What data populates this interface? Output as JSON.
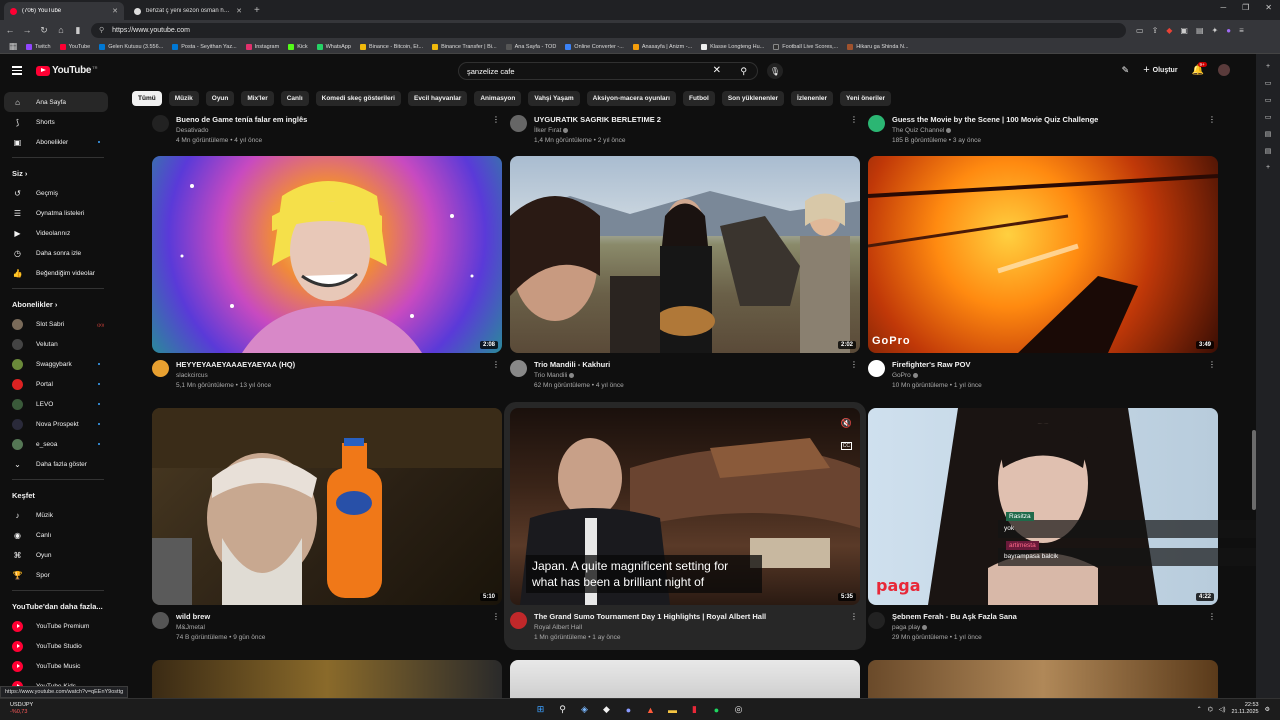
{
  "browser": {
    "tabs": [
      {
        "title": "(706) YouTube",
        "active": true
      },
      {
        "title": "behzat ç yeni sezon osman harun - G",
        "active": false
      }
    ],
    "new_tab": "+",
    "url": "https://www.youtube.com",
    "bookmarks": [
      "Twitch",
      "YouTube",
      "Gelen Kutusu (3.556...",
      "Posta - Seyithan Yaz...",
      "Instagram",
      "Kick",
      "WhatsApp",
      "Binance - Bitcoin, Et...",
      "Binance Transfer | Bi...",
      "Ana Sayfa - TOD",
      "Online Converter -...",
      "Anasayfa | Anizm -...",
      "Klasse Longteng Hu...",
      "Football Live Scores,...",
      "Hikaru ga Shinda N..."
    ],
    "status_url": "https://www.youtube.com/watch?v=qEEnY9osttg"
  },
  "header": {
    "logo_text": "YouTube",
    "country": "TR",
    "search_value": "şanzelize cafe",
    "create_label": "Oluştur",
    "notif_count": "9+"
  },
  "chips": [
    "Tümü",
    "Müzik",
    "Oyun",
    "Mix'ler",
    "Canlı",
    "Komedi skeç gösterileri",
    "Evcil hayvanlar",
    "Animasyon",
    "Vahşi Yaşam",
    "Aksiyon-macera oyunları",
    "Futbol",
    "Son yüklenenler",
    "İzlenenler",
    "Yeni öneriler"
  ],
  "sidebar": {
    "main": [
      {
        "label": "Ana Sayfa",
        "icon": "home-icon"
      },
      {
        "label": "Shorts",
        "icon": "shorts-icon"
      },
      {
        "label": "Abonelikler",
        "icon": "subscriptions-icon"
      }
    ],
    "you_title": "Siz",
    "you": [
      {
        "label": "Geçmiş",
        "icon": "history-icon"
      },
      {
        "label": "Oynatma listeleri",
        "icon": "playlists-icon"
      },
      {
        "label": "Videolarınız",
        "icon": "your-videos-icon"
      },
      {
        "label": "Daha sonra izle",
        "icon": "watch-later-icon"
      },
      {
        "label": "Beğendiğim videolar",
        "icon": "liked-icon"
      }
    ],
    "subs_title": "Abonelikler",
    "subs": [
      {
        "label": "Slot Sabri",
        "color": "#7a6b5a"
      },
      {
        "label": "Velutan",
        "color": "#444444"
      },
      {
        "label": "Swaggybark",
        "color": "#6a8a3a"
      },
      {
        "label": "Portal",
        "color": "#dd2222"
      },
      {
        "label": "LEVO",
        "color": "#3a5a3a"
      },
      {
        "label": "Nova Prospekt",
        "color": "#2a2a3a"
      },
      {
        "label": "e_seoa",
        "color": "#557755"
      }
    ],
    "show_more": "Daha fazla göster",
    "explore_title": "Keşfet",
    "explore": [
      {
        "label": "Müzik",
        "icon": "music-icon"
      },
      {
        "label": "Canlı",
        "icon": "live-icon"
      },
      {
        "label": "Oyun",
        "icon": "gaming-icon"
      },
      {
        "label": "Spor",
        "icon": "sports-icon"
      }
    ],
    "more_title": "YouTube'dan daha fazla...",
    "more": [
      "YouTube Premium",
      "YouTube Studio",
      "YouTube Music",
      "YouTube Kids"
    ]
  },
  "top_row": [
    {
      "title": "Bueno de Game tenía falar em inglês",
      "channel": "Desativado",
      "stats": "4 Mn görüntüleme • 4 yıl önce"
    },
    {
      "title": "UYGURATIK SAGRIK BERLETIME 2",
      "channel": "İlker Fırat",
      "stats": "1,4 Mn görüntüleme • 2 yıl önce"
    },
    {
      "title": "Guess the Movie by the Scene | 100 Movie Quiz Challenge",
      "channel": "The Quiz Channel",
      "stats": "185 B görüntüleme • 3 ay önce"
    }
  ],
  "videos": [
    {
      "title": "HEYYEYAAEYAAAEYAEYAA (HQ)",
      "channel": "slackcircus",
      "stats": "5,1 Mn görüntüleme • 13 yıl önce",
      "duration": "2:08"
    },
    {
      "title": "Trio Mandili - Kakhuri",
      "channel": "Trio Mandili",
      "stats": "62 Mn görüntüleme • 4 yıl önce",
      "duration": "2:02"
    },
    {
      "title": "Firefighter's Raw POV",
      "channel": "GoPro",
      "stats": "10 Mn görüntüleme • 1 yıl önce",
      "duration": "3:49"
    },
    {
      "title": "wild brew",
      "channel": "M&Jmetal",
      "stats": "74 B görüntüleme • 9 gün önce",
      "duration": "5:10"
    },
    {
      "title": "The Grand Sumo Tournament Day 1 Highlights | Royal Albert Hall",
      "channel": "Royal Albert Hall",
      "stats": "1 Mn görüntüleme • 1 ay önce",
      "duration": "5:35",
      "subtitle": "Japan. A quite magnificent setting for what has been a brilliant night of"
    },
    {
      "title": "Şebnem Ferah - Bu Aşk Fazla Sana",
      "channel": "paga play",
      "stats": "29 Mn görüntüleme • 1 yıl önce",
      "duration": "4:22"
    }
  ],
  "overlays": {
    "gopro": "GoPro",
    "paga": "paga",
    "chat_user1": "Rasitza",
    "chat_msg1": "yok",
    "chat_user2": "artimesta",
    "chat_msg2": "bayrampasa balcik"
  },
  "taskbar": {
    "ticker": "USD/JPY",
    "change": "-%0,73",
    "time": "22:53",
    "date": "21.11.2025"
  }
}
